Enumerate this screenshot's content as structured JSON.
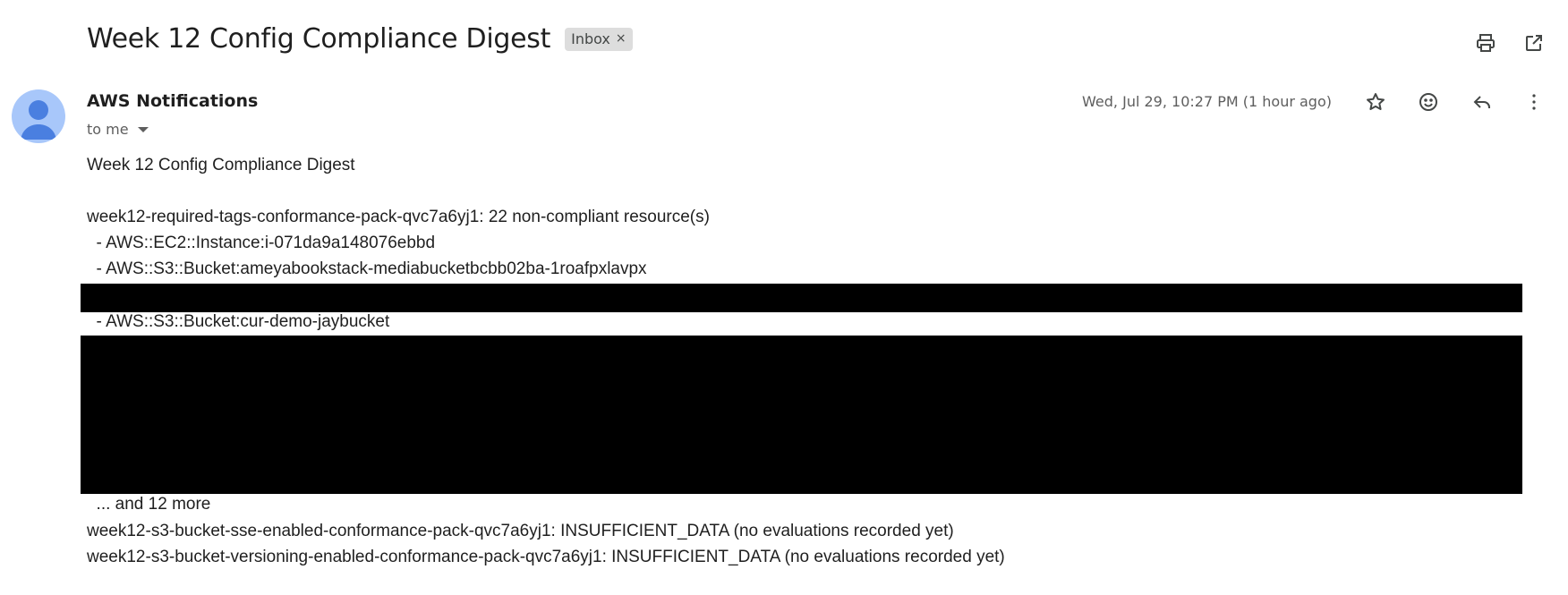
{
  "email": {
    "subject": "Week 12 Config Compliance Digest",
    "label": "Inbox",
    "label_close": "×",
    "sender": "AWS Notifications",
    "recipient": "to me",
    "date": "Wed, Jul 29, 10:27 PM (1 hour ago)"
  },
  "body_lines": {
    "heading": "Week 12 Config Compliance Digest",
    "rule1": "week12-required-tags-conformance-pack-qvc7a6yj1: 22 non-compliant resource(s)",
    "res1": "  - AWS::EC2::Instance:i-071da9a148076ebbd",
    "res2": "  - AWS::S3::Bucket:ameyabookstack-mediabucketbcbb02ba-1roafpxlavpx",
    "res3": "  - AWS::S3::Bucket:cur-demo-jaybucket",
    "more": "  ... and 12 more",
    "rule2": "week12-s3-bucket-sse-enabled-conformance-pack-qvc7a6yj1: INSUFFICIENT_DATA (no evaluations recorded yet)",
    "rule3": "week12-s3-bucket-versioning-enabled-conformance-pack-qvc7a6yj1: INSUFFICIENT_DATA (no evaluations recorded yet)"
  },
  "icons": {
    "print": "print-icon",
    "open_new_window": "open-in-new-window-icon",
    "star": "star-icon",
    "emoji": "emoji-icon",
    "reply": "reply-icon",
    "more": "more-vert-icon",
    "avatar": "avatar-person-icon"
  },
  "colors": {
    "avatar_bg": "#a8c7fa",
    "avatar_fg": "#4a7fe0",
    "chip_bg": "#dddddd",
    "redaction": "#000000"
  }
}
